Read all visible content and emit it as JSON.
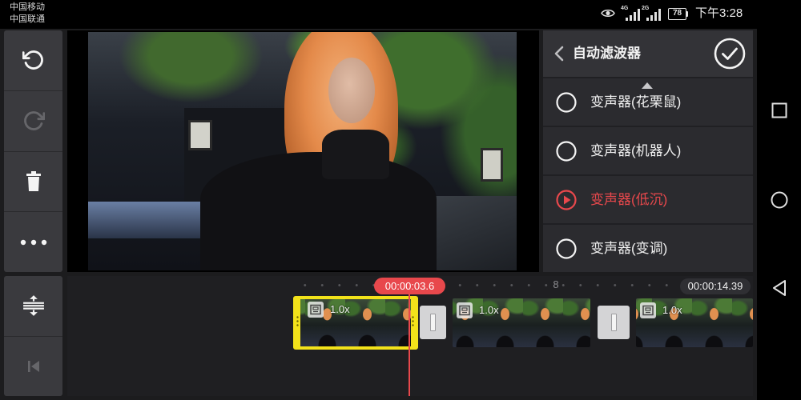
{
  "status_bar": {
    "carriers": [
      "中国移动",
      "中国联通"
    ],
    "eye_icon": "eye-icon",
    "network_1": "4G",
    "network_2": "2G",
    "signal_icon": "signal-bars-icon",
    "battery_level": "78",
    "time": "下午3:28"
  },
  "toolbar": {
    "top_group": [
      {
        "icon": "undo-icon",
        "disabled": false
      },
      {
        "icon": "redo-icon",
        "disabled": true
      },
      {
        "icon": "trash-icon",
        "disabled": false
      },
      {
        "icon": "more-dots-icon",
        "disabled": false
      }
    ],
    "bottom_group": [
      {
        "icon": "expand-timeline-icon",
        "disabled": false
      },
      {
        "icon": "skip-to-start-icon",
        "disabled": true
      }
    ]
  },
  "filter_panel": {
    "back_icon": "chevron-left-icon",
    "title": "自动滤波器",
    "confirm_icon": "check-circle-icon",
    "scroll_icon": "scroll-up-triangle-icon",
    "items": [
      {
        "label": "变声器(花栗鼠)",
        "selected": false,
        "icon": "radio-circle-icon"
      },
      {
        "label": "变声器(机器人)",
        "selected": false,
        "icon": "radio-circle-icon"
      },
      {
        "label": "变声器(低沉)",
        "selected": true,
        "icon": "play-circle-icon"
      },
      {
        "label": "变声器(变调)",
        "selected": false,
        "icon": "radio-circle-icon"
      }
    ]
  },
  "timeline": {
    "current_time": "00:00:03.6",
    "ruler_marker": "8",
    "total_time": "00:00:14.39",
    "clips": [
      {
        "speed": "1.0x",
        "selected": true,
        "icon": "film-clip-icon"
      },
      {
        "speed": "1.0x",
        "selected": false,
        "icon": "film-clip-icon"
      },
      {
        "speed": "1.0x",
        "selected": false,
        "icon": "film-clip-icon"
      }
    ],
    "transitions": [
      {
        "icon": "transition-icon"
      },
      {
        "icon": "transition-icon"
      }
    ]
  },
  "nav_bar": {
    "icons": [
      "recent-apps-icon",
      "home-icon",
      "back-icon"
    ]
  },
  "colors": {
    "accent_red": "#e8484c",
    "selection_yellow": "#f2e21a",
    "toolbar_bg": "#3a3a3e",
    "panel_bg": "#2b2b2f",
    "panel_header_bg": "#333337",
    "timeline_bg": "#1f1f22",
    "app_bg": "#1c1c1e"
  }
}
